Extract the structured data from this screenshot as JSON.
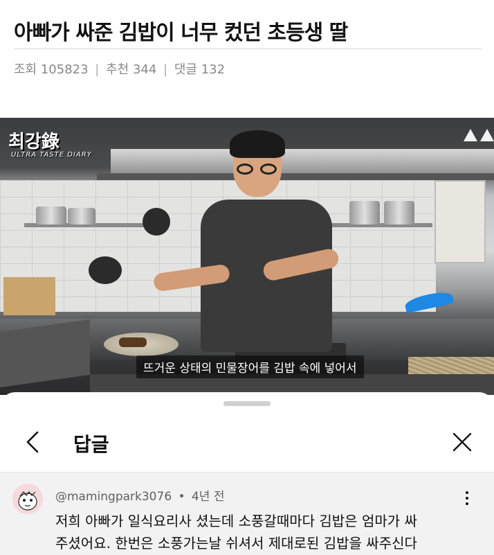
{
  "post": {
    "title": "아빠가 싸준 김밥이 너무 컸던 초등생 딸",
    "stats": {
      "views_label": "조회 105823",
      "likes_label": "추천 344",
      "comments_label": "댓글 132",
      "separator": "|"
    }
  },
  "video": {
    "watermark": "최강錄",
    "watermark_sub": "ULTRA TASTE DIARY",
    "caption": "뜨거운 상태의 민물장어를 김밥 속에 넣어서",
    "icons": [
      "warning-icon",
      "warning-icon"
    ]
  },
  "reply_sheet": {
    "title": "답글",
    "back_icon": "chevron-left-icon",
    "close_icon": "close-icon",
    "comment": {
      "author": "@mamingpark3076",
      "dot": "•",
      "time": "4년 전",
      "more_icon": "more-vertical-icon",
      "lines": [
        "저희 아빠가 일식요리사 셨는데 소풍갈때마다 김밥은 엄마가 싸",
        "주셨어요. 한번은 소풍가는날 쉬셔서 제대로된 김밥을 싸주신다"
      ]
    }
  },
  "colors": {
    "text_primary": "#0f0f0f",
    "text_secondary": "#606060",
    "comment_bg": "#f2f2f2"
  }
}
